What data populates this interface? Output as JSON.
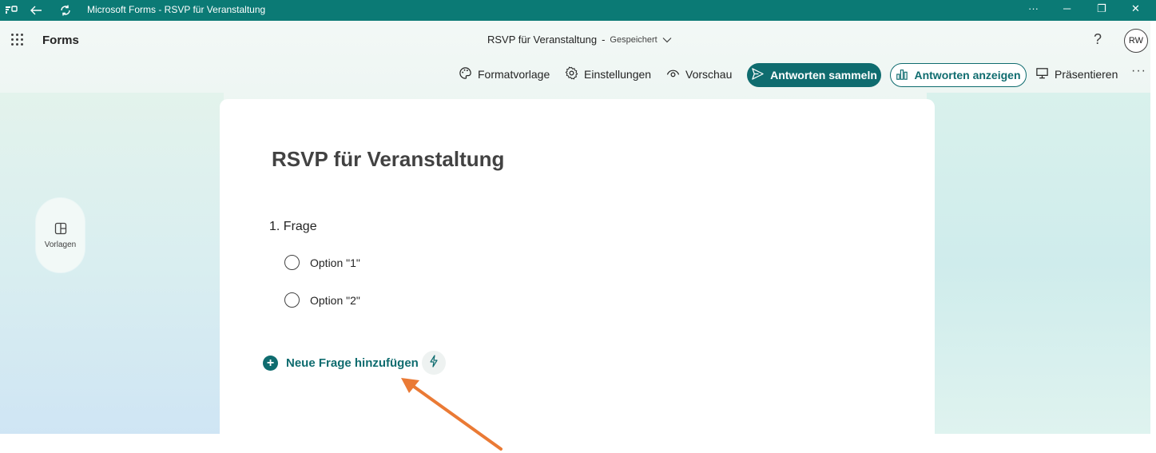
{
  "window": {
    "title": "Microsoft Forms - RSVP für Veranstaltung",
    "minimize_glyph": "─",
    "restore_glyph": "❐",
    "close_glyph": "✕",
    "more_glyph": "···"
  },
  "header": {
    "app_name": "Forms",
    "form_name": "RSVP für Veranstaltung",
    "separator": "-",
    "status": "Gespeichert",
    "help_glyph": "?",
    "avatar_initials": "RW"
  },
  "toolbar": {
    "theme_label": "Formatvorlage",
    "settings_label": "Einstellungen",
    "preview_label": "Vorschau",
    "collect_label": "Antworten sammeln",
    "view_label": "Antworten anzeigen",
    "present_label": "Präsentieren",
    "more_glyph": "···"
  },
  "sidebar": {
    "templates_label": "Vorlagen"
  },
  "form": {
    "title": "RSVP für Veranstaltung",
    "question": {
      "number": "1.",
      "text": "Frage",
      "options": [
        "Option \"1\"",
        "Option \"2\""
      ]
    },
    "add_question_label": "Neue Frage hinzufügen"
  },
  "colors": {
    "titlebar": "#0b7a75",
    "accent": "#0f6c6f",
    "annotation_arrow": "#ea7a35"
  }
}
